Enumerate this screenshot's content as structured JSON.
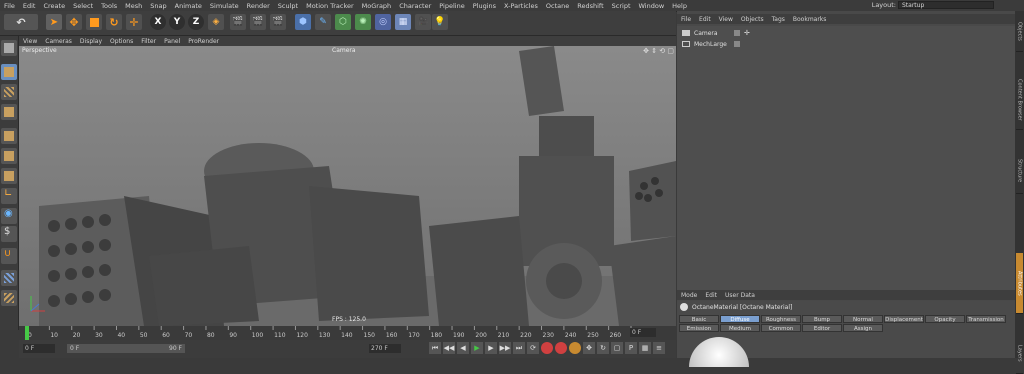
{
  "menubar": {
    "items": [
      "File",
      "Edit",
      "Create",
      "Select",
      "Tools",
      "Mesh",
      "Snap",
      "Animate",
      "Simulate",
      "Render",
      "Sculpt",
      "Motion Tracker",
      "MoGraph",
      "Character",
      "Pipeline",
      "Plugins",
      "X-Particles",
      "Octane",
      "Redshift",
      "Script",
      "Window",
      "Help"
    ],
    "layout_label": "Layout:",
    "layout_value": "Startup"
  },
  "toolbar": {
    "axis_x": "X",
    "axis_y": "Y",
    "axis_z": "Z"
  },
  "viewport": {
    "menu": [
      "View",
      "Cameras",
      "Display",
      "Options",
      "Filter",
      "Panel",
      "ProRender"
    ],
    "name": "Perspective",
    "camera": "Camera",
    "fps": "FPS : 125.0"
  },
  "timeline": {
    "ticks": [
      "0",
      "5",
      "10",
      "15",
      "20",
      "25",
      "30",
      "35",
      "40",
      "45",
      "50",
      "55",
      "60",
      "65",
      "70",
      "75",
      "80",
      "85",
      "90",
      "95",
      "100",
      "105",
      "110",
      "115",
      "120",
      "125",
      "130",
      "135",
      "140",
      "145",
      "150",
      "155",
      "160",
      "165",
      "170",
      "175",
      "180",
      "185",
      "190",
      "195",
      "200",
      "205",
      "210",
      "215",
      "220",
      "225",
      "230",
      "235",
      "240",
      "245",
      "250",
      "255",
      "260",
      "265",
      "270"
    ],
    "frame_end": "0 F"
  },
  "playbar": {
    "start": "0 F",
    "current": "0 F",
    "mid": "90 F",
    "end": "270 F"
  },
  "objects": {
    "menu": [
      "File",
      "Edit",
      "View",
      "Objects",
      "Tags",
      "Bookmarks"
    ],
    "items": [
      {
        "name": "Camera"
      },
      {
        "name": "MechLarge"
      }
    ]
  },
  "attributes": {
    "menu": [
      "Mode",
      "Edit",
      "User Data"
    ],
    "material_name": "OctaneMaterial [Octane Material]",
    "tabs_row1": [
      "Basic",
      "Diffuse",
      "Roughness",
      "Bump",
      "Normal",
      "Displacement",
      "Opacity",
      "Transmission"
    ],
    "tabs_row2": [
      "Emission",
      "Medium",
      "Common",
      "Editor",
      "Assign"
    ],
    "active_tab": "Diffuse"
  },
  "sidetabs": [
    "Objects",
    "Content Browser",
    "Structure",
    "Attributes",
    "Layers"
  ],
  "colors": {
    "accent": "#7a9fd0",
    "playhead": "#46c846",
    "record": "#d04040"
  }
}
